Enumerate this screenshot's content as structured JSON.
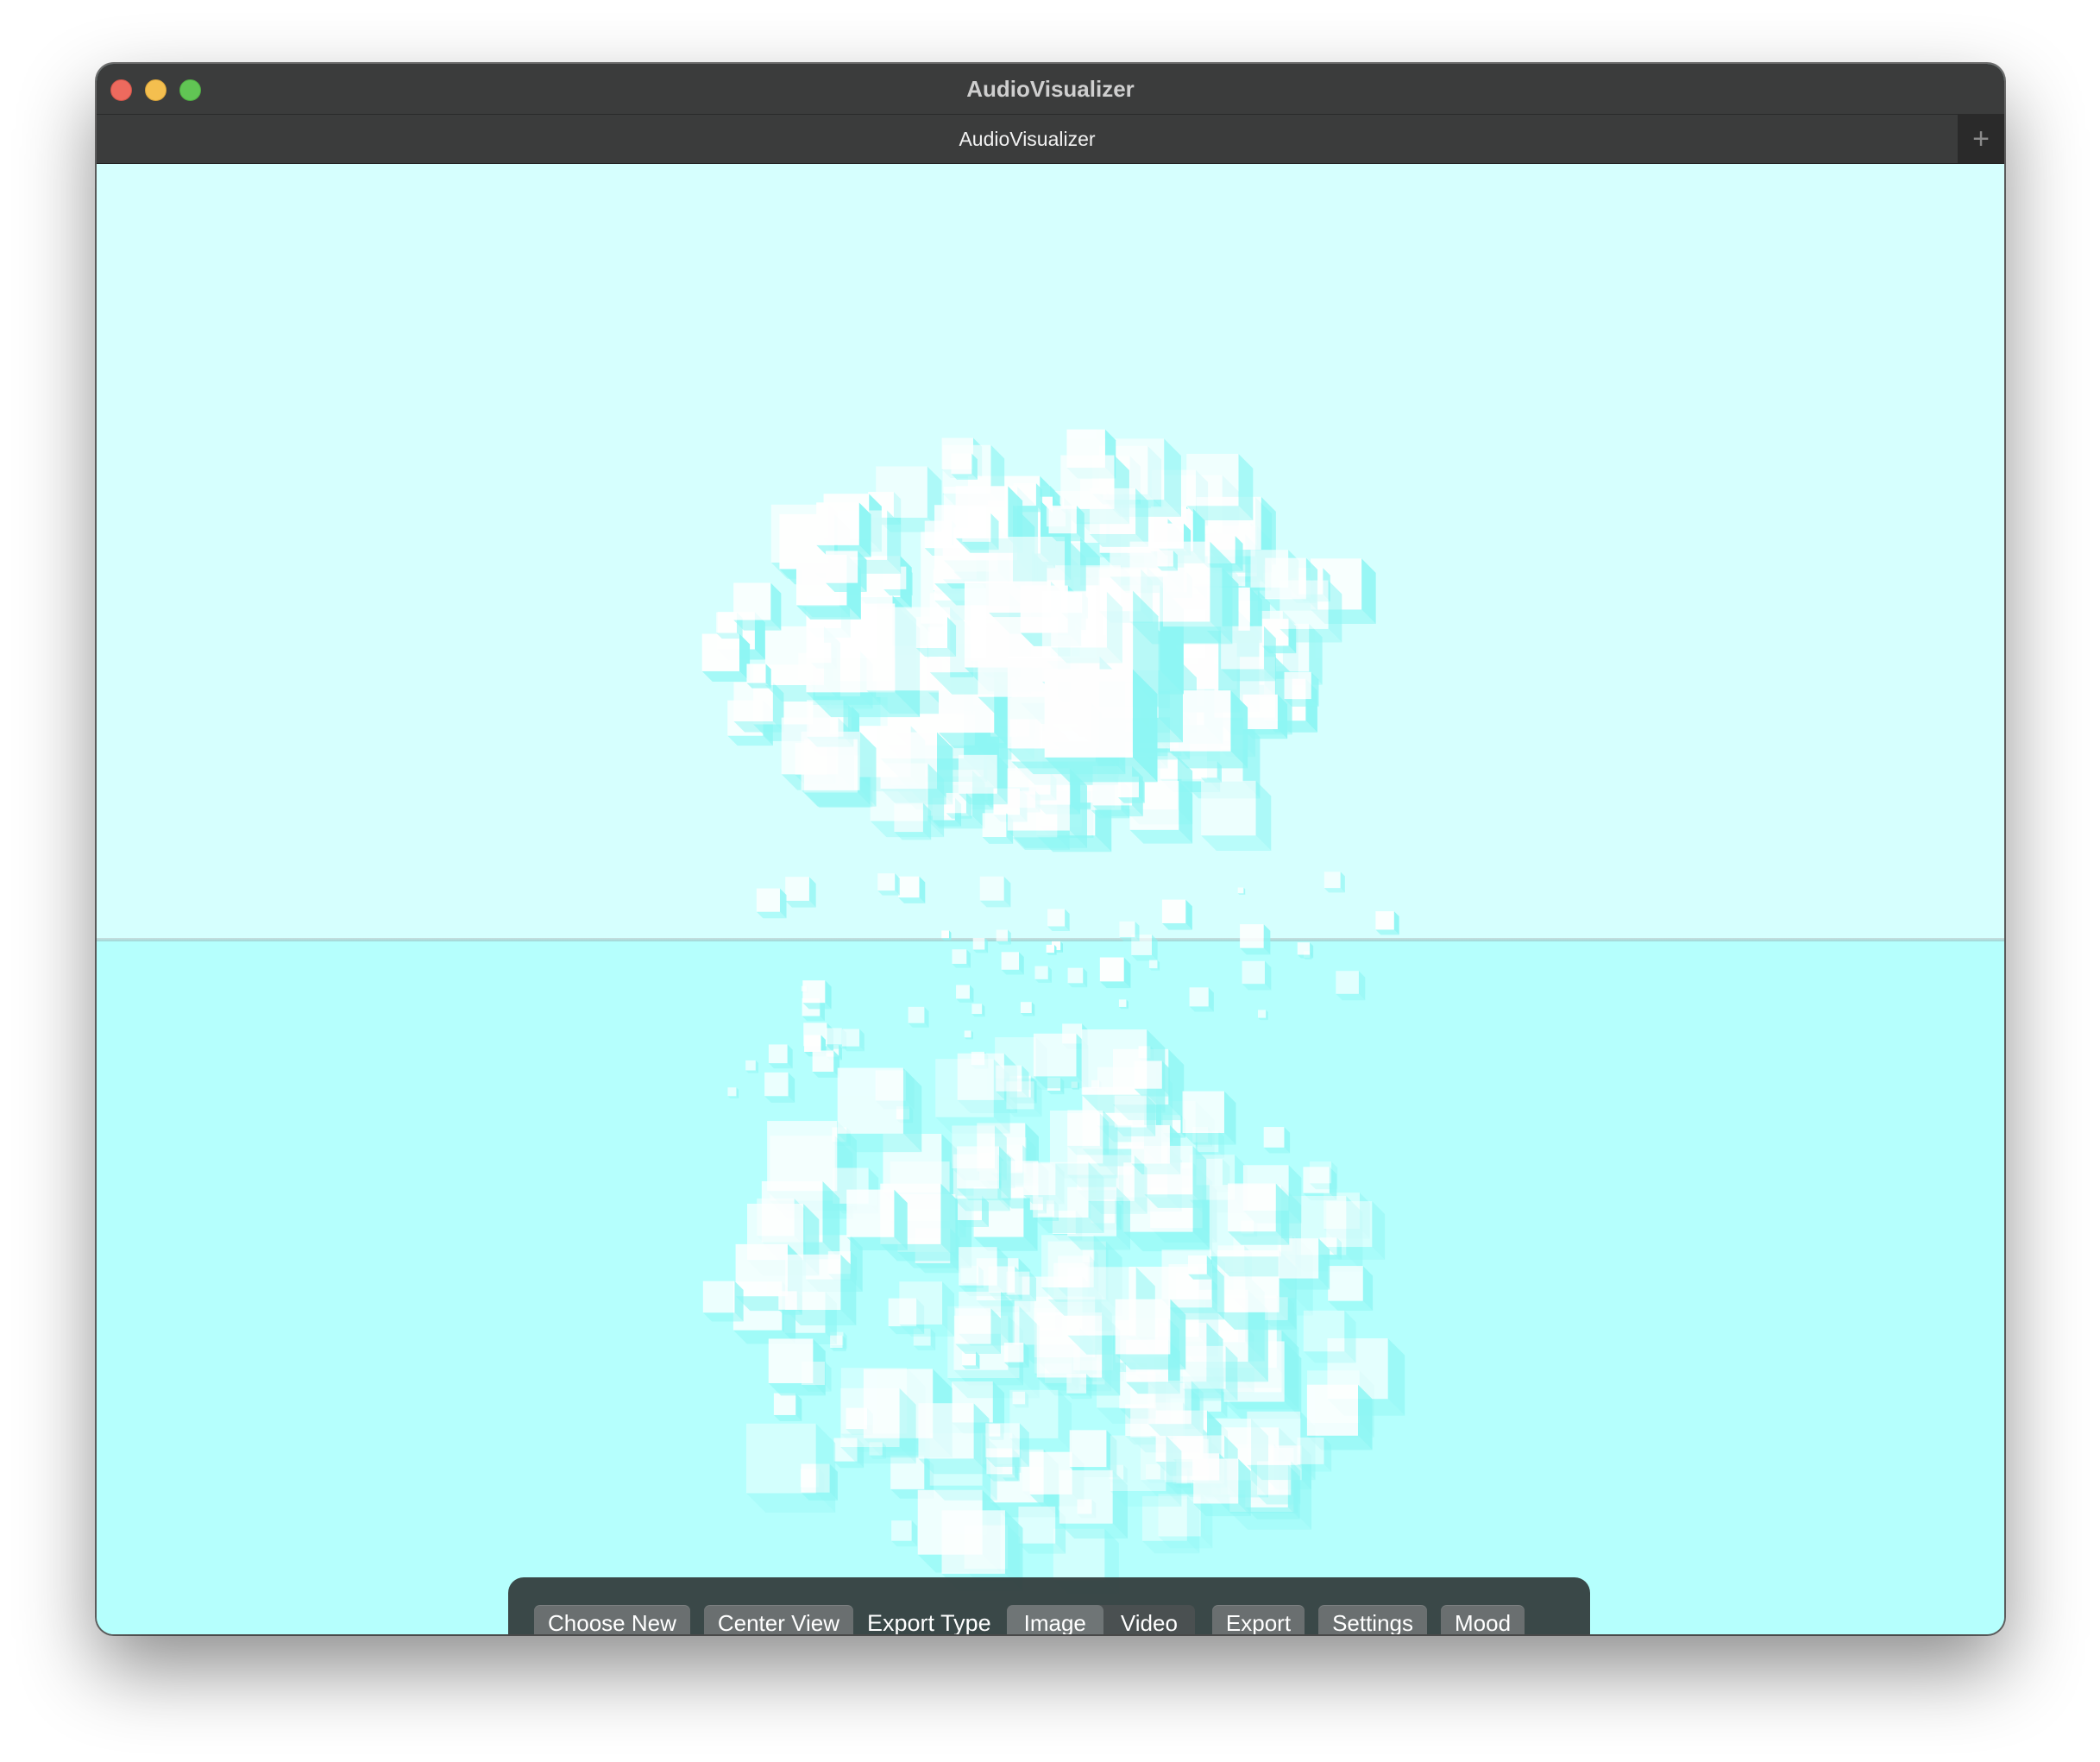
{
  "window": {
    "title": "AudioVisualizer",
    "tab_label": "AudioVisualizer",
    "new_tab_glyph": "+"
  },
  "scene": {
    "sky_color": "#d6fffe",
    "ground_color": "#b5fffd",
    "cube_color": "#ffffff",
    "cube_shade": "#8ef6f4"
  },
  "toolbar": {
    "choose_new": "Choose New",
    "center_view": "Center View",
    "export_type_label": "Export Type",
    "export_type_options": [
      "Image",
      "Video"
    ],
    "export_type_selected": "Image",
    "export": "Export",
    "settings": "Settings",
    "mood": "Mood"
  }
}
